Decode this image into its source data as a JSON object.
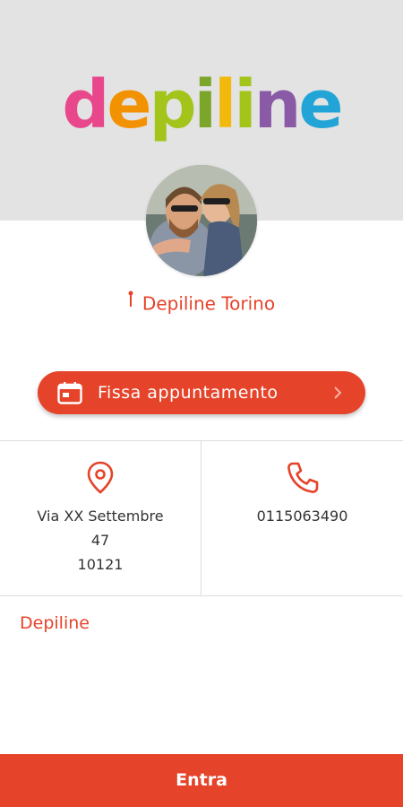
{
  "brand": {
    "logo_text": "depiline",
    "logo_letters": [
      {
        "ch": "d",
        "color": "#e8478b"
      },
      {
        "ch": "e",
        "color": "#f39200"
      },
      {
        "ch": "p",
        "color": "#a3c41b"
      },
      {
        "ch": "i",
        "color": "#7ba62a"
      },
      {
        "ch": "l",
        "color": "#f2b90c"
      },
      {
        "ch": "i",
        "color": "#a3c41b"
      },
      {
        "ch": "n",
        "color": "#8a5aa6"
      },
      {
        "ch": "e",
        "color": "#22a5d6"
      }
    ]
  },
  "store": {
    "name": "Depiline Torino"
  },
  "actions": {
    "book_label": "Fissa appuntamento",
    "enter_label": "Entra"
  },
  "contact": {
    "address_line1": "Via XX Settembre",
    "address_line2": "47",
    "address_line3": "10121",
    "phone": "0115063490"
  },
  "description": "Depiline",
  "colors": {
    "accent": "#e5432a",
    "header_bg": "#e3e3e3",
    "text": "#333333"
  },
  "icons": {
    "location": "map-pin-icon",
    "calendar": "calendar-icon",
    "chevron": "chevron-right-icon",
    "phone": "phone-icon"
  }
}
